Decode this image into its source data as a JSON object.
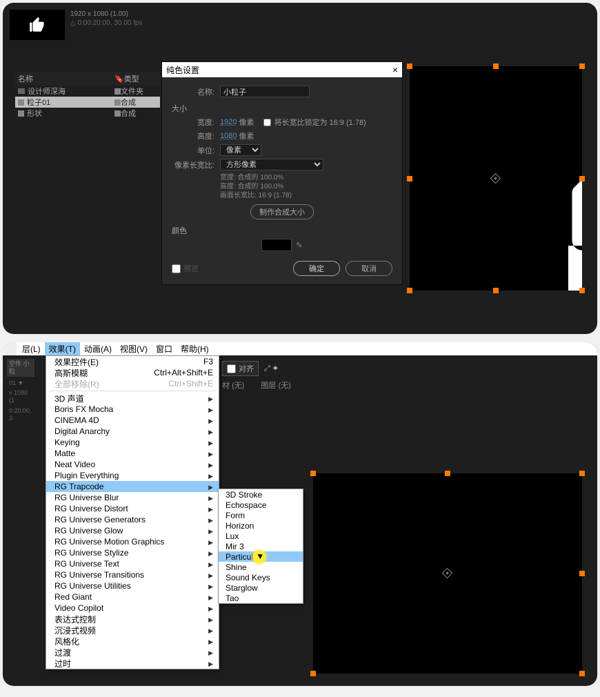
{
  "panel1": {
    "meta_line1": "1920 x 1080 (1.00)",
    "meta_line2": "△ 0:00:20:00, 30.00 fps",
    "project": {
      "col_name": "名称",
      "col_type": "类型",
      "rows": [
        {
          "icon": "folder",
          "name": "设计师深海",
          "type": "文件夹"
        },
        {
          "icon": "comp",
          "name": "粒子01",
          "type": "合成",
          "selected": true
        },
        {
          "icon": "comp",
          "name": "形状",
          "type": "合成"
        }
      ]
    },
    "dialog": {
      "title": "纯色设置",
      "close": "×",
      "name_label": "名称:",
      "name_value": "小粒子",
      "section_size": "大小",
      "width_label": "宽度:",
      "width_value": "1920",
      "width_unit": "像素",
      "height_label": "高度:",
      "height_value": "1080",
      "height_unit": "像素",
      "lock_ratio": "将长宽比锁定为 16:9 (1.78)",
      "unit_label": "单位:",
      "unit_value": "像素",
      "par_label": "像素长宽比:",
      "par_value": "方形像素",
      "ratio_w": "宽度: 合成的 100.0%",
      "ratio_h": "高度: 合成的 100.0%",
      "ratio_frame": "画面长宽比: 16:9 (1.78)",
      "make_btn": "制作合成大小",
      "section_color": "颜色",
      "preview": "预览",
      "ok": "确定",
      "cancel": "取消"
    }
  },
  "panel2": {
    "menubar": [
      "层(L)",
      "效果(T)",
      "动画(A)",
      "视图(V)",
      "窗口",
      "帮助(H)"
    ],
    "menubar_hl_index": 1,
    "left": {
      "tab": "空件 小粒",
      "info1": "01 ▼",
      "info2": "x 1080 (1",
      "info3": "0:20:00, 3"
    },
    "dropdown": [
      {
        "label": "效果控件(E)",
        "shortcut": "F3"
      },
      {
        "label": "高斯模糊",
        "shortcut": "Ctrl+Alt+Shift+E"
      },
      {
        "label": "全部移除(R)",
        "shortcut": "Ctrl+Shift+E",
        "disabled": true
      },
      {
        "sep": true
      },
      {
        "label": "3D 声道",
        "arrow": true
      },
      {
        "label": "Boris FX Mocha",
        "arrow": true
      },
      {
        "label": "CINEMA 4D",
        "arrow": true
      },
      {
        "label": "Digital Anarchy",
        "arrow": true
      },
      {
        "label": "Keying",
        "arrow": true
      },
      {
        "label": "Matte",
        "arrow": true
      },
      {
        "label": "Neat Video",
        "arrow": true
      },
      {
        "label": "Plugin Everything",
        "arrow": true
      },
      {
        "label": "RG Trapcode",
        "arrow": true,
        "hl": true
      },
      {
        "label": "RG Universe Blur",
        "arrow": true
      },
      {
        "label": "RG Universe Distort",
        "arrow": true
      },
      {
        "label": "RG Universe Generators",
        "arrow": true
      },
      {
        "label": "RG Universe Glow",
        "arrow": true
      },
      {
        "label": "RG Universe Motion Graphics",
        "arrow": true
      },
      {
        "label": "RG Universe Stylize",
        "arrow": true
      },
      {
        "label": "RG Universe Text",
        "arrow": true
      },
      {
        "label": "RG Universe Transitions",
        "arrow": true
      },
      {
        "label": "RG Universe Utilities",
        "arrow": true
      },
      {
        "label": "Red Giant",
        "arrow": true
      },
      {
        "label": "Video Copilot",
        "arrow": true
      },
      {
        "label": "表达式控制",
        "arrow": true
      },
      {
        "label": "沉浸式视频",
        "arrow": true
      },
      {
        "label": "风格化",
        "arrow": true
      },
      {
        "label": "过渡",
        "arrow": true
      },
      {
        "label": "过时",
        "arrow": true
      }
    ],
    "submenu": [
      "3D Stroke",
      "Echospace",
      "Form",
      "Horizon",
      "Lux",
      "Mir 3",
      "Particular",
      "Shine",
      "Sound Keys",
      "Starglow",
      "Tao"
    ],
    "submenu_hl_index": 6,
    "toolbar": {
      "align": "对齐",
      "layer_label": "材",
      "layer_val": "(无)",
      "layer2_label": "图层",
      "layer2_val": "(无)"
    }
  }
}
